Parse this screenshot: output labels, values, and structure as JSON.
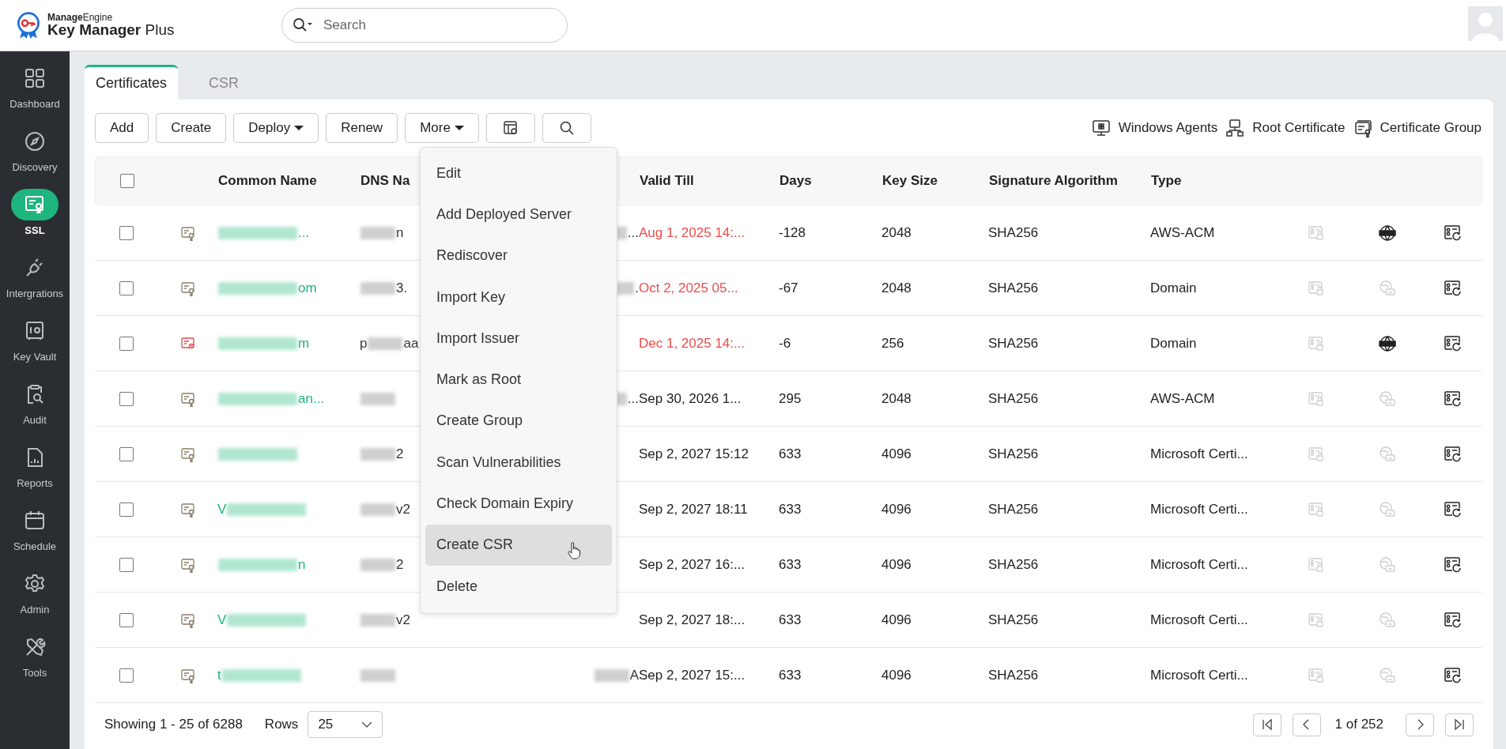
{
  "header": {
    "brand_top": "**Manage**Engine",
    "brand_name": "**Key Manager** Plus",
    "search": {
      "placeholder": "Search"
    }
  },
  "sidebar": {
    "items": [
      {
        "label": "Dashboard",
        "selected": false
      },
      {
        "label": "Discovery",
        "selected": false
      },
      {
        "label": "SSL",
        "selected": true
      },
      {
        "label": "Intergrations",
        "selected": false
      },
      {
        "label": "Key Vault",
        "selected": false
      },
      {
        "label": "Audit",
        "selected": false
      },
      {
        "label": "Reports",
        "selected": false
      },
      {
        "label": "Schedule",
        "selected": false
      },
      {
        "label": "Admin",
        "selected": false
      },
      {
        "label": "Tools",
        "selected": false
      }
    ]
  },
  "tabs": [
    {
      "label": "Certificates",
      "selected": true
    },
    {
      "label": "CSR",
      "selected": false
    }
  ],
  "toolbar": {
    "buttons": [
      {
        "label": "Add",
        "dropdown": false
      },
      {
        "label": "Create",
        "dropdown": false
      },
      {
        "label": "Deploy",
        "dropdown": true
      },
      {
        "label": "Renew",
        "dropdown": false
      },
      {
        "label": "More",
        "dropdown": true
      }
    ],
    "links": [
      {
        "label": "Windows Agents"
      },
      {
        "label": "Root Certificate"
      },
      {
        "label": "Certificate Group"
      }
    ]
  },
  "more_menu": {
    "items": [
      {
        "label": "Edit",
        "selected": false
      },
      {
        "label": "Add Deployed Server",
        "selected": false
      },
      {
        "label": "Rediscover",
        "selected": false
      },
      {
        "label": "Import Key",
        "selected": false
      },
      {
        "label": "Import Issuer",
        "selected": false
      },
      {
        "label": "Mark as Root",
        "selected": false
      },
      {
        "label": "Create Group",
        "selected": false
      },
      {
        "label": "Scan Vulnerabilities",
        "selected": false
      },
      {
        "label": "Check Domain Expiry",
        "selected": false
      },
      {
        "label": "Create CSR",
        "selected": true
      },
      {
        "label": "Delete",
        "selected": false
      }
    ]
  },
  "table": {
    "all_checked": false,
    "columns": [
      "Common Name",
      "DNS Na",
      "Valid Till",
      "Days",
      "Key Size",
      "Signature Algorithm",
      "Type"
    ],
    "rows": [
      {
        "checked": false,
        "alert": false,
        "name": {
          "text": "..."
        },
        "dns": {
          "text": "n"
        },
        "column_3": {
          "text": "..."
        },
        "valid_till": "Aug 1, 2025 14:...",
        "expired": true,
        "days": "-128",
        "key_size": "2048",
        "algorithm": "SHA256",
        "type": "AWS-ACM",
        "dns_record": true
      },
      {
        "checked": false,
        "alert": false,
        "name": {
          "text": "om"
        },
        "dns": {
          "text": "3."
        },
        "column_3": {
          "text": "."
        },
        "valid_till": "Oct 2, 2025 05...",
        "expired": true,
        "days": "-67",
        "key_size": "2048",
        "algorithm": "SHA256",
        "type": "Domain",
        "dns_record": false
      },
      {
        "checked": false,
        "alert": true,
        "name": {
          "text": "m"
        },
        "dns": {
          "prefix": "p",
          "text": "aa"
        },
        "valid_till": "Dec 1, 2025 14:...",
        "expired": true,
        "days": "-6",
        "key_size": "256",
        "algorithm": "SHA256",
        "type": "Domain",
        "dns_record": true
      },
      {
        "checked": false,
        "alert": false,
        "name": {
          "text": "an..."
        },
        "dns": {},
        "column_3": {
          "text": "..."
        },
        "valid_till": "Sep 30, 2026 1...",
        "expired": false,
        "days": "295",
        "key_size": "2048",
        "algorithm": "SHA256",
        "type": "AWS-ACM",
        "dns_record": false
      },
      {
        "checked": false,
        "alert": false,
        "name": {},
        "dns": {
          "text": "2"
        },
        "valid_till": "Sep 2, 2027 15:12",
        "expired": false,
        "days": "633",
        "key_size": "4096",
        "algorithm": "SHA256",
        "type": "Microsoft Certi...",
        "dns_record": false
      },
      {
        "checked": false,
        "alert": false,
        "name": {
          "prefix": "V"
        },
        "dns": {
          "text": "v2"
        },
        "valid_till": "Sep 2, 2027 18:11",
        "expired": false,
        "days": "633",
        "key_size": "4096",
        "algorithm": "SHA256",
        "type": "Microsoft Certi...",
        "dns_record": false
      },
      {
        "checked": false,
        "alert": false,
        "name": {
          "text": "n"
        },
        "dns": {
          "text": "2"
        },
        "valid_till": "Sep 2, 2027 16:...",
        "expired": false,
        "days": "633",
        "key_size": "4096",
        "algorithm": "SHA256",
        "type": "Microsoft Certi...",
        "dns_record": false
      },
      {
        "checked": false,
        "alert": false,
        "name": {
          "prefix": "V"
        },
        "dns": {
          "text": "v2"
        },
        "valid_till": "Sep 2, 2027 18:...",
        "expired": false,
        "days": "633",
        "key_size": "4096",
        "algorithm": "SHA256",
        "type": "Microsoft Certi...",
        "dns_record": false
      },
      {
        "checked": false,
        "alert": false,
        "name": {
          "prefix": "t"
        },
        "dns": {},
        "column_3": {
          "text": "A"
        },
        "valid_till": "Sep 2, 2027 15:...",
        "expired": false,
        "days": "633",
        "key_size": "4096",
        "algorithm": "SHA256",
        "type": "Microsoft Certi...",
        "dns_record": false
      }
    ]
  },
  "footer": {
    "showing": "Showing 1 - 25 of 6288",
    "rows_label": "Rows",
    "rows_value": "25",
    "page": "1 of 252"
  }
}
